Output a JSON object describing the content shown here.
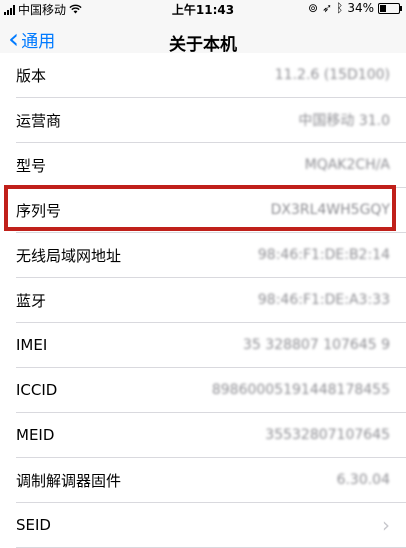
{
  "status": {
    "carrier": "中国移动",
    "time": "上午11:43",
    "battery_percent": "34%",
    "battery_level": 0.34
  },
  "nav": {
    "back_label": "通用",
    "title": "关于本机"
  },
  "rows": [
    {
      "label": "版本",
      "value": "11.2.6 (15D100)"
    },
    {
      "label": "运营商",
      "value": "中国移动 31.0"
    },
    {
      "label": "型号",
      "value": "MQAK2CH/A"
    },
    {
      "label": "序列号",
      "value": "DX3RL4WH5GQY"
    },
    {
      "label": "无线局域网地址",
      "value": "98:46:F1:DE:B2:14"
    },
    {
      "label": "蓝牙",
      "value": "98:46:F1:DE:A3:33"
    },
    {
      "label": "IMEI",
      "value": "35 328807 107645 9"
    },
    {
      "label": "ICCID",
      "value": "89860005191448178455"
    },
    {
      "label": "MEID",
      "value": "35532807107645"
    },
    {
      "label": "调制解调器固件",
      "value": "6.30.04"
    },
    {
      "label": "SEID",
      "value": ""
    }
  ]
}
